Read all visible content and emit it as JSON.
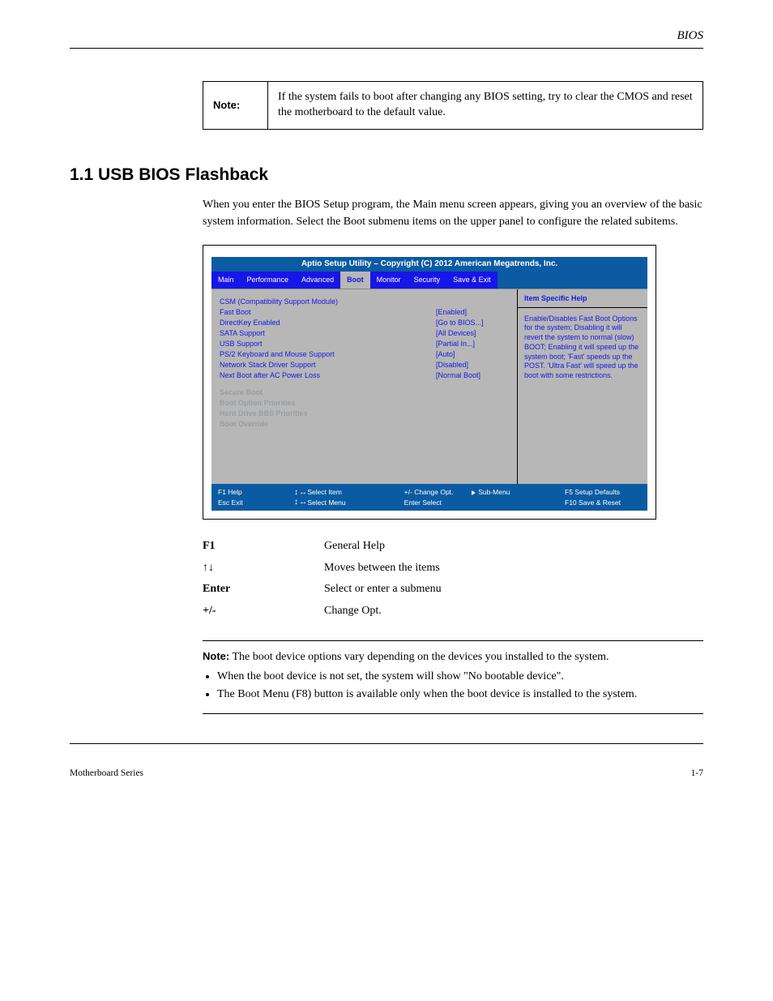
{
  "header": {
    "title": "BIOS"
  },
  "note_table": {
    "left": "Note:",
    "right": "If the system fails to boot after changing any BIOS setting, try to clear the CMOS and reset the motherboard to the default value."
  },
  "section_title": "1.1 USB BIOS Flashback",
  "intro_paragraphs": [
    "When you enter the BIOS Setup program, the Main menu screen appears, giving you an overview of the basic system information. Select the Boot submenu items on the upper panel to configure the related subitems."
  ],
  "bios": {
    "title": "Aptio Setup Utility – Copyright (C) 2012 American Megatrends, Inc.",
    "tabs": [
      "Main",
      "Performance",
      "Advanced",
      "Boot",
      "Monitor",
      "Security",
      "Save & Exit"
    ],
    "active_tab": 3,
    "boot_items": [
      {
        "label": "CSM (Compatibility Support Module)",
        "value": ""
      },
      {
        "label": "Fast Boot",
        "value": "[Enabled]"
      },
      {
        "label": "DirectKey Enabled",
        "value": "[Go to BIOS...]"
      },
      {
        "label": "SATA Support",
        "value": "[All Devices]"
      },
      {
        "label": "USB Support",
        "value": "[Partial In...]"
      },
      {
        "label": "PS/2 Keyboard and Mouse Support",
        "value": "[Auto]"
      },
      {
        "label": "Network Stack Driver Support",
        "value": "[Disabled]"
      },
      {
        "label": "Next Boot after AC Power Loss",
        "value": "[Normal Boot]"
      }
    ],
    "sub_items": [
      "Secure Boot",
      "Boot Option Priorities",
      "Hard Drive BBS Priorities",
      "Boot Override"
    ],
    "side_title": "Item Specific Help",
    "side_body": "Enable/Disables Fast Boot Options for the system; Disabling it will revert the system to normal (slow) BOOT; Enabling it will speed up the system boot; 'Fast' speeds up the POST. 'Ultra Fast' will speed up the boot with some restrictions.",
    "footer": {
      "c1": [
        "F1  Help",
        "Esc  Exit"
      ],
      "c2_top": "Select Item",
      "c2_bot": "Select Menu",
      "c3": [
        "+/-  Change Opt.",
        "Enter  Select"
      ],
      "c3_arrow": "Sub-Menu",
      "c4": [
        "F5  Setup Defaults",
        "F10  Save & Reset"
      ]
    }
  },
  "legend": {
    "rows": [
      {
        "key": "F1",
        "desc": "General Help"
      },
      {
        "key": "↑↓",
        "desc": "Moves between the items"
      },
      {
        "key": "Enter",
        "desc": "Select or enter a submenu"
      },
      {
        "key": "+/-",
        "desc": "Change Opt."
      }
    ]
  },
  "note2": {
    "lead": "Note:",
    "intro": "The boot device options vary depending on the devices you installed to the system.",
    "bullets": [
      "When the boot device is not set, the system will show \"No bootable device\".",
      "The Boot Menu (F8) button is available only when the boot device is installed to the system."
    ]
  },
  "pagefoot": {
    "left": "Motherboard Series",
    "right": "1-7"
  }
}
